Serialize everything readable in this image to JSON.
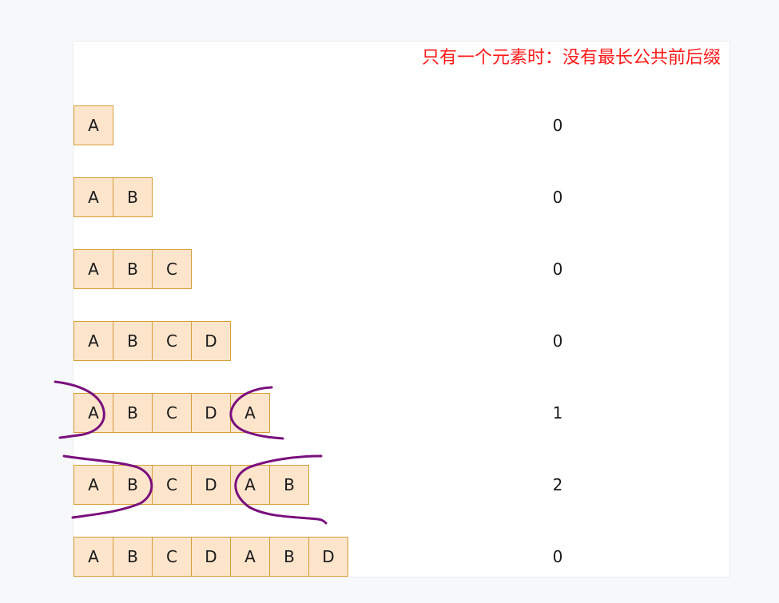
{
  "note": "只有一个元素时：没有最长公共前后缀",
  "rows": [
    {
      "cells": [
        "A"
      ],
      "value": "0"
    },
    {
      "cells": [
        "A",
        "B"
      ],
      "value": "0"
    },
    {
      "cells": [
        "A",
        "B",
        "C"
      ],
      "value": "0"
    },
    {
      "cells": [
        "A",
        "B",
        "C",
        "D"
      ],
      "value": "0"
    },
    {
      "cells": [
        "A",
        "B",
        "C",
        "D",
        "A"
      ],
      "value": "1"
    },
    {
      "cells": [
        "A",
        "B",
        "C",
        "D",
        "A",
        "B"
      ],
      "value": "2"
    },
    {
      "cells": [
        "A",
        "B",
        "C",
        "D",
        "A",
        "B",
        "D"
      ],
      "value": "0"
    }
  ],
  "colors": {
    "note": "#ff1a1a",
    "cell_fill": "#fde5cc",
    "cell_border": "#d69e38",
    "annotation": "#7a0f7d"
  }
}
